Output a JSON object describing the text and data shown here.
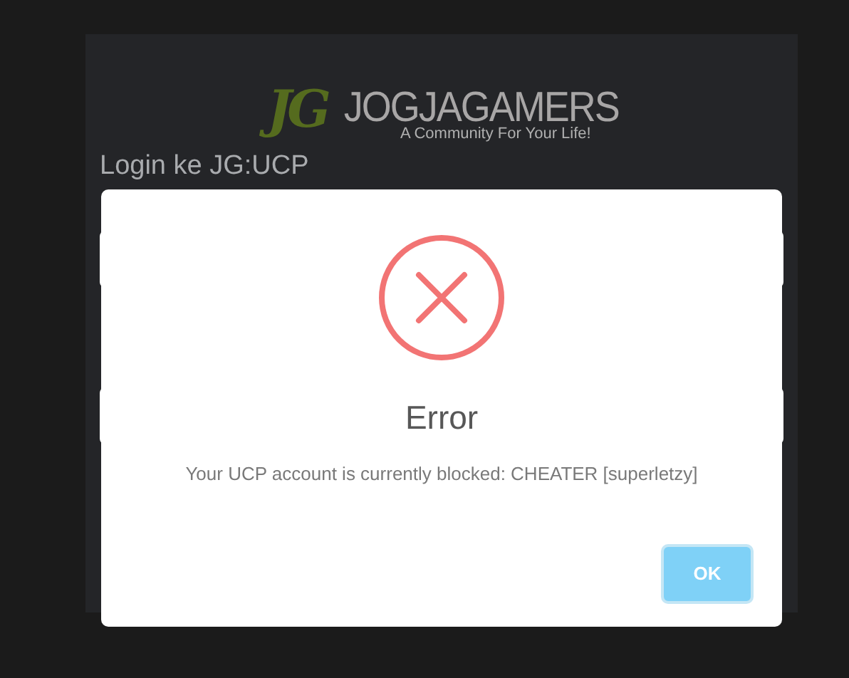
{
  "logo": {
    "initials": "JG",
    "name": "JOGJAGAMERS",
    "tagline": "A Community For Your Life!"
  },
  "heading": "Login ke JG:UCP",
  "dialog": {
    "title": "Error",
    "message": "Your UCP account is currently blocked: CHEATER [superletzy]",
    "buttons": [
      "OK"
    ]
  }
}
